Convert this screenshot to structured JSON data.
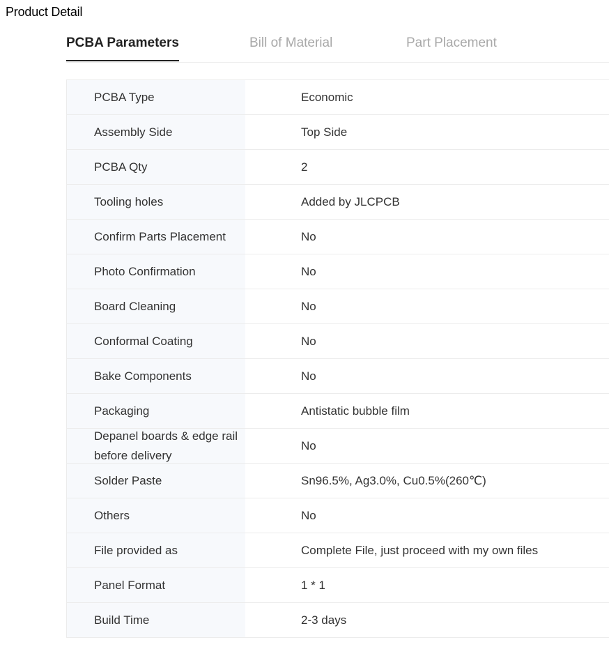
{
  "page": {
    "title": "Product Detail"
  },
  "tabs": [
    {
      "label": "PCBA Parameters",
      "active": true
    },
    {
      "label": "Bill of Material",
      "active": false
    },
    {
      "label": "Part Placement",
      "active": false
    }
  ],
  "parameters": [
    {
      "label": "PCBA Type",
      "value": "Economic"
    },
    {
      "label": "Assembly Side",
      "value": "Top Side"
    },
    {
      "label": "PCBA Qty",
      "value": "2"
    },
    {
      "label": "Tooling holes",
      "value": "Added by JLCPCB"
    },
    {
      "label": "Confirm Parts Placement",
      "value": "No"
    },
    {
      "label": "Photo Confirmation",
      "value": "No"
    },
    {
      "label": "Board Cleaning",
      "value": "No"
    },
    {
      "label": "Conformal Coating",
      "value": "No"
    },
    {
      "label": "Bake Components",
      "value": "No"
    },
    {
      "label": "Packaging",
      "value": "Antistatic bubble film"
    },
    {
      "label": "Depanel boards & edge rail before delivery",
      "value": "No"
    },
    {
      "label": "Solder Paste",
      "value": "Sn96.5%, Ag3.0%, Cu0.5%(260℃)"
    },
    {
      "label": "Others",
      "value": "No"
    },
    {
      "label": "File provided as",
      "value": "Complete File, just proceed with my own files"
    },
    {
      "label": "Panel Format",
      "value": "1 * 1"
    },
    {
      "label": "Build Time",
      "value": "2-3 days"
    }
  ]
}
